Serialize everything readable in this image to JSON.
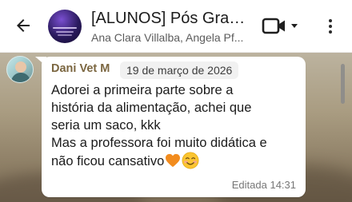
{
  "header": {
    "back_icon": "arrow-back-icon",
    "title": "[ALUNOS] Pós Graduação em Nutrição",
    "subtitle": "Ana Clara Villalba, Angela Pf...",
    "video_icon": "video-call-icon",
    "more_icon": "more-vert-icon"
  },
  "message": {
    "sender": "Dani Vet M",
    "date": "19 de março de 2026",
    "lines": [
      "Adorei a primeira parte sobre a",
      "história da alimentação, achei que",
      "seria um saco, kkk",
      "Mas a professora foi muito didática e",
      "não ficou cansativo"
    ],
    "emojis": [
      "orange-heart-icon",
      "smiling-face-icon"
    ],
    "footer": "Editada 14:31",
    "sender_color": "#7b6640"
  },
  "colors": {
    "bubble": "#ffffff",
    "chat_background": "#a99c81"
  }
}
